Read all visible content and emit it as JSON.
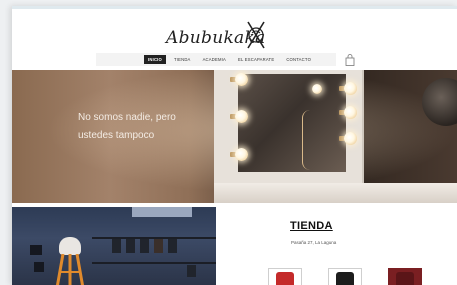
{
  "brand": {
    "name": "Abubukaka"
  },
  "nav": {
    "items": [
      {
        "label": "INICIO",
        "active": true
      },
      {
        "label": "TIENDA",
        "active": false
      },
      {
        "label": "ACADEMIA",
        "active": false
      },
      {
        "label": "EL ESCAPARATE",
        "active": false
      },
      {
        "label": "CONTACTO",
        "active": false
      }
    ],
    "cart_icon": "shopping-bag-icon"
  },
  "hero": {
    "text": "No somos nadie, pero ustedes tampoco"
  },
  "shop": {
    "title": "TIENDA",
    "subtitle": "Pasaña 27, La Laguna",
    "products": [
      {
        "color": "#c42a2a"
      },
      {
        "color": "#1c1c1c"
      },
      {
        "color": "#7a1f22"
      }
    ]
  },
  "colors": {
    "nav_active_bg": "#222222",
    "hero_text": "#f4ece4"
  }
}
